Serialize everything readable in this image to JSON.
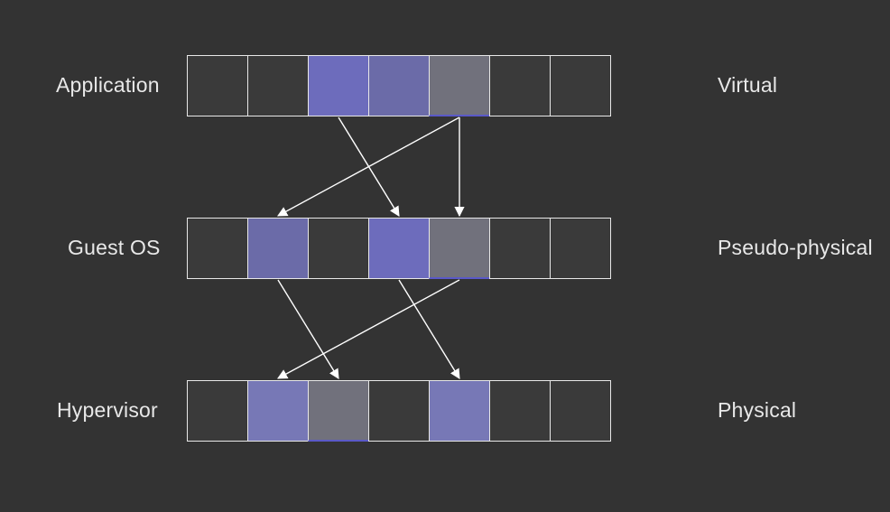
{
  "rows": [
    {
      "leftLabel": "Application",
      "rightLabel": "Virtual"
    },
    {
      "leftLabel": "Guest OS",
      "rightLabel": "Pseudo-physical"
    },
    {
      "leftLabel": "Hypervisor",
      "rightLabel": "Physical"
    }
  ],
  "layout": {
    "cellSize": 68,
    "rowX": 207,
    "rowYs": [
      61,
      241,
      421
    ],
    "cellsPerRow": 7
  },
  "highlights": {
    "row0": [
      {
        "index": 2,
        "style": "purple"
      },
      {
        "index": 3,
        "style": "purple-mid"
      },
      {
        "index": 4,
        "style": "grey"
      }
    ],
    "row1": [
      {
        "index": 1,
        "style": "purple-mid"
      },
      {
        "index": 3,
        "style": "purple"
      },
      {
        "index": 4,
        "style": "grey"
      }
    ],
    "row2": [
      {
        "index": 1,
        "style": "purple-light"
      },
      {
        "index": 2,
        "style": "grey2"
      },
      {
        "index": 4,
        "style": "purple-light"
      }
    ]
  },
  "arrows": [
    {
      "from": [
        0,
        4
      ],
      "to": [
        1,
        1
      ]
    },
    {
      "from": [
        0,
        2
      ],
      "to": [
        1,
        3
      ]
    },
    {
      "from": [
        0,
        4
      ],
      "to": [
        1,
        4
      ]
    },
    {
      "from": [
        1,
        4
      ],
      "to": [
        2,
        1
      ]
    },
    {
      "from": [
        1,
        1
      ],
      "to": [
        2,
        2
      ]
    },
    {
      "from": [
        1,
        3
      ],
      "to": [
        2,
        4
      ]
    }
  ]
}
